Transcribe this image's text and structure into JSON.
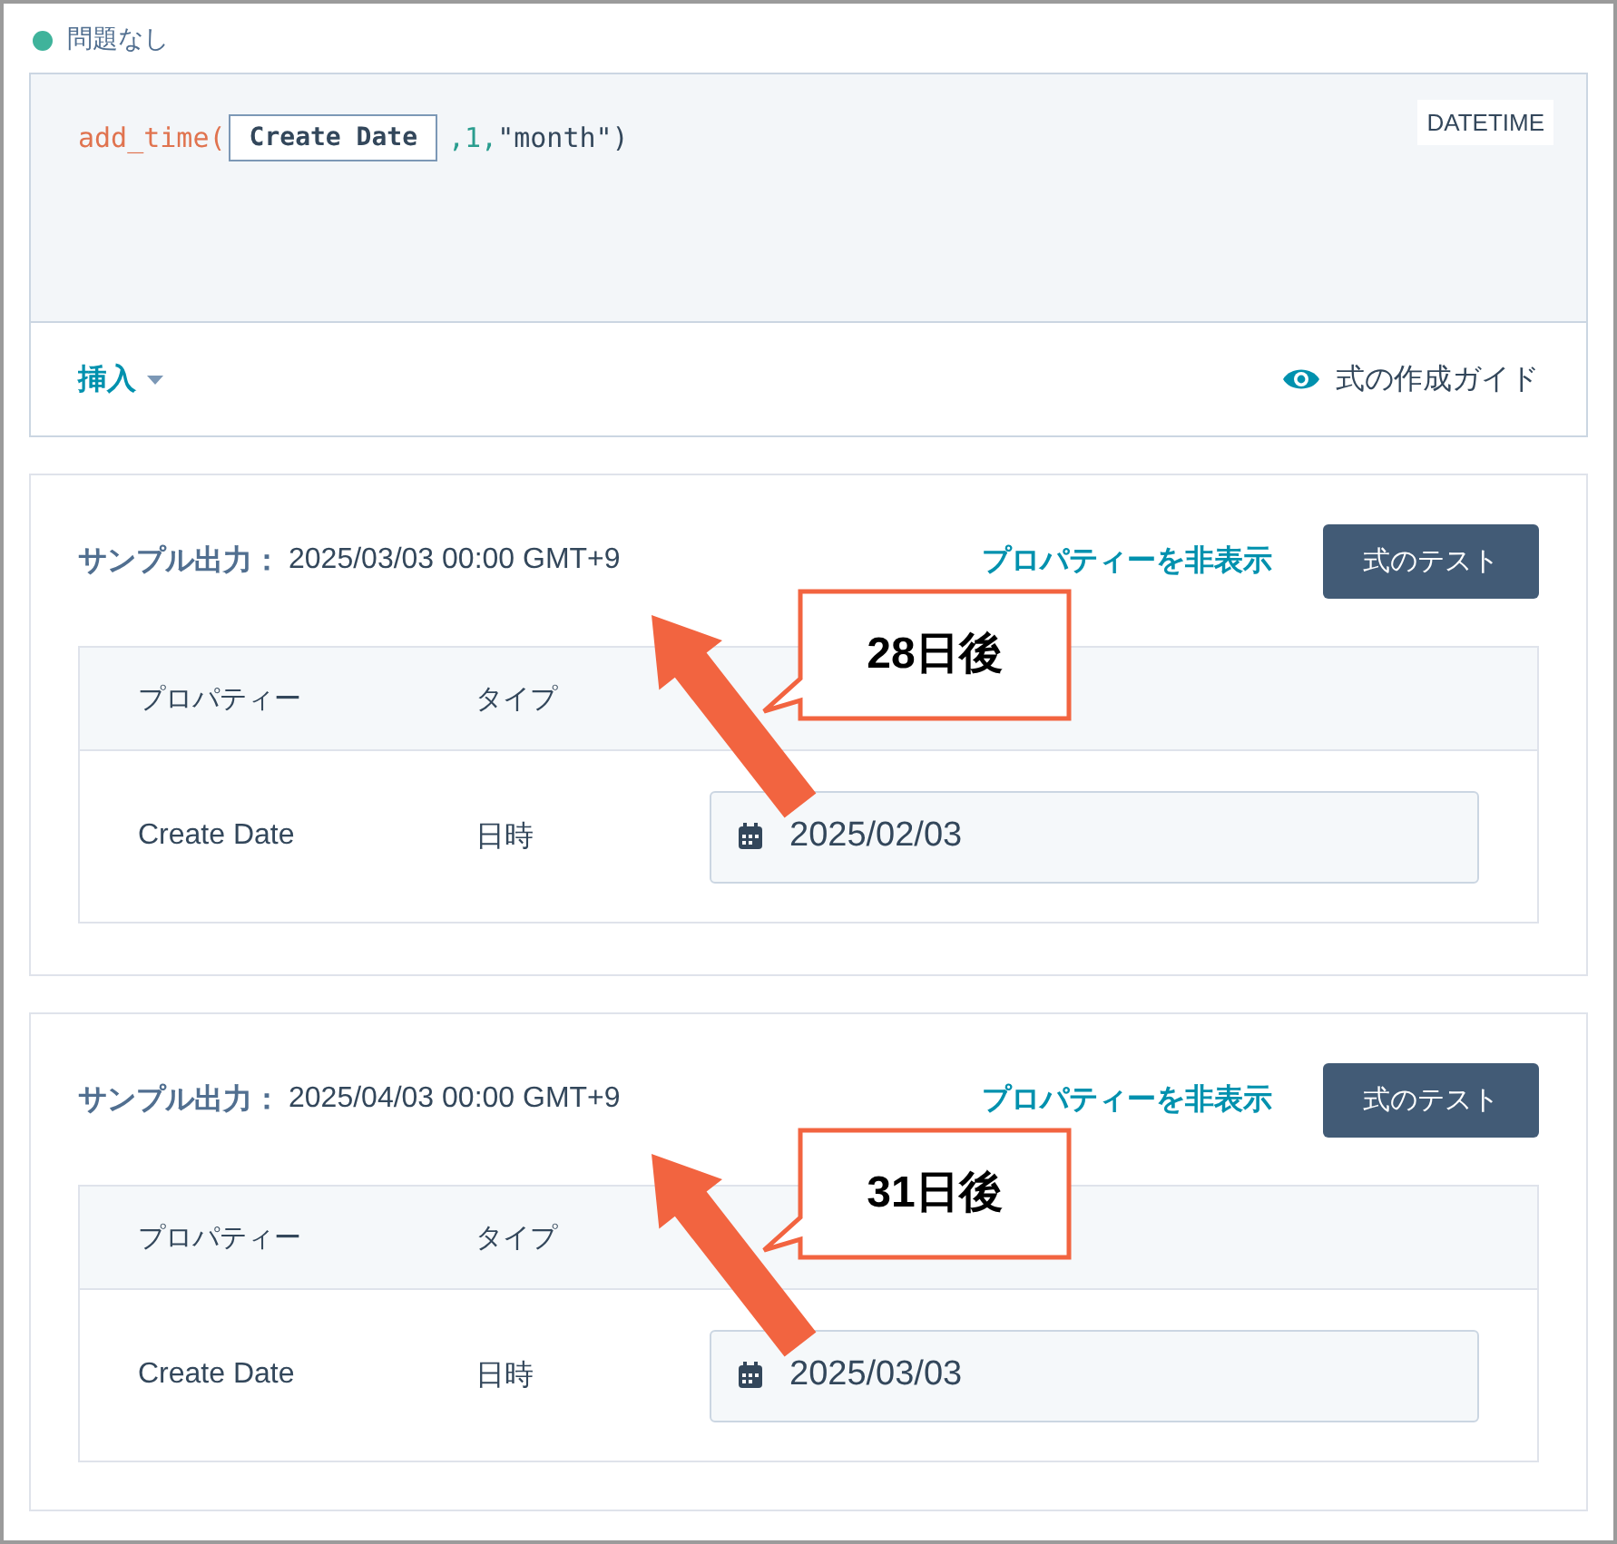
{
  "status": {
    "text": "問題なし"
  },
  "editor": {
    "code": [
      {
        "kind": "function",
        "text": "add_time("
      },
      {
        "kind": "token",
        "text": "Create Date"
      },
      {
        "kind": "number",
        "text": ",1,"
      },
      {
        "kind": "string",
        "text": "\"month\")"
      }
    ],
    "type_badge": "DATETIME",
    "insert_menu": "挿入",
    "guide_link": "式の作成ガイド"
  },
  "samples": [
    {
      "label": "サンプル出力：",
      "value": "2025/03/03 00:00 GMT+9",
      "hide_link": "プロパティーを非表示",
      "test_button": "式のテスト",
      "columns": [
        "プロパティー",
        "タイプ"
      ],
      "rows": [
        {
          "property": "Create Date",
          "type": "日時",
          "date": "2025/02/03"
        }
      ],
      "callout": "28日後"
    },
    {
      "label": "サンプル出力：",
      "value": "2025/04/03 00:00 GMT+9",
      "hide_link": "プロパティーを非表示",
      "test_button": "式のテスト",
      "columns": [
        "プロパティー",
        "タイプ"
      ],
      "rows": [
        {
          "property": "Create Date",
          "type": "日時",
          "date": "2025/03/03"
        }
      ],
      "callout": "31日後"
    }
  ]
}
